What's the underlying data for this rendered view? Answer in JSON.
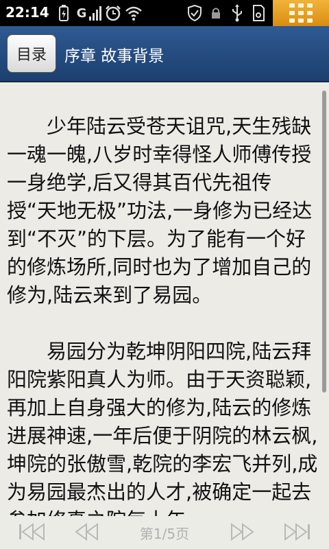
{
  "status_bar": {
    "time": "22:14",
    "icons": [
      "battery-icon",
      "g-network-icon",
      "signal-bars-icon",
      "alarm-clock-icon",
      "wifi-icon",
      "shield-icon",
      "lock-icon",
      "usb-icon",
      "sd-card-icon"
    ],
    "menu_color": "#e29b1f"
  },
  "header": {
    "toc_label": "目录",
    "chapter_title": "序章 故事背景",
    "background_color": "#25497d"
  },
  "content": {
    "paragraphs": [
      "少年陆云受苍天诅咒,天生残缺一魂一魄,八岁时幸得怪人师傅传授一身绝学,后又得其百代先祖传授“天地无极”功法,一身修为已经达到“不灭”的下层。为了能有一个好的修炼场所,同时也为了增加自己的修为,陆云来到了易园。",
      "易园分为乾坤阴阳四院,陆云拜阳院紫阳真人为师。由于天资聪颖,再加上自身强大的修为,陆云的修炼进展神速,一年后便于阴院的林云枫,坤院的张傲雪,乾院的李宏飞并列,成为易园最杰出的人才,被确定一起去参加修真之院每十年"
    ]
  },
  "footer": {
    "page_indicator": "第1/5页",
    "buttons": [
      "first-page",
      "previous-page",
      "next-page",
      "last-page"
    ]
  }
}
